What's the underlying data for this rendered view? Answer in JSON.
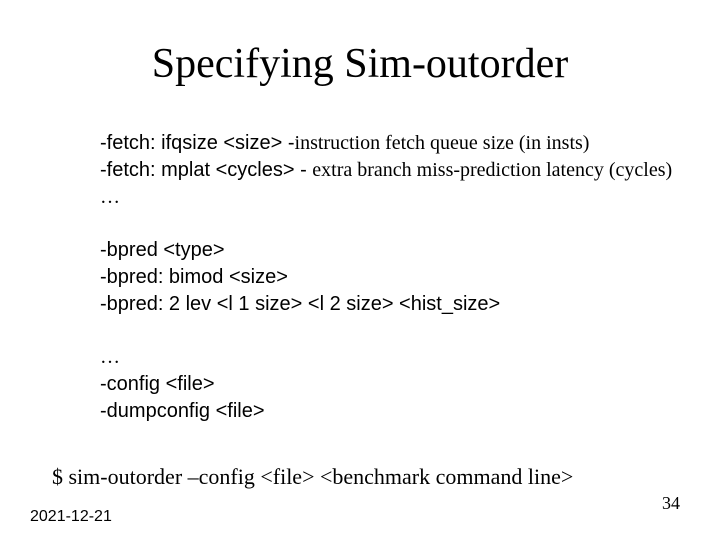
{
  "title": "Specifying Sim-outorder",
  "block1": {
    "l1_opt": "-fetch: ifqsize <size> -",
    "l1_desc": "instruction fetch queue size (in insts)",
    "l2_opt": "-fetch: mplat <cycles> - ",
    "l2_desc": "extra branch miss-prediction latency (cycles)",
    "l3": "…"
  },
  "block2": {
    "l1": "-bpred <type>",
    "l2": "-bpred: bimod <size>",
    "l3": "-bpred: 2 lev <l 1 size> <l 2 size> <hist_size>"
  },
  "block3": {
    "l1": "…",
    "l2": "-config <file>",
    "l3": "-dumpconfig <file>"
  },
  "cmdline": "$ sim-outorder –config <file> <benchmark command line>",
  "date": "2021-12-21",
  "pagenum": "34"
}
